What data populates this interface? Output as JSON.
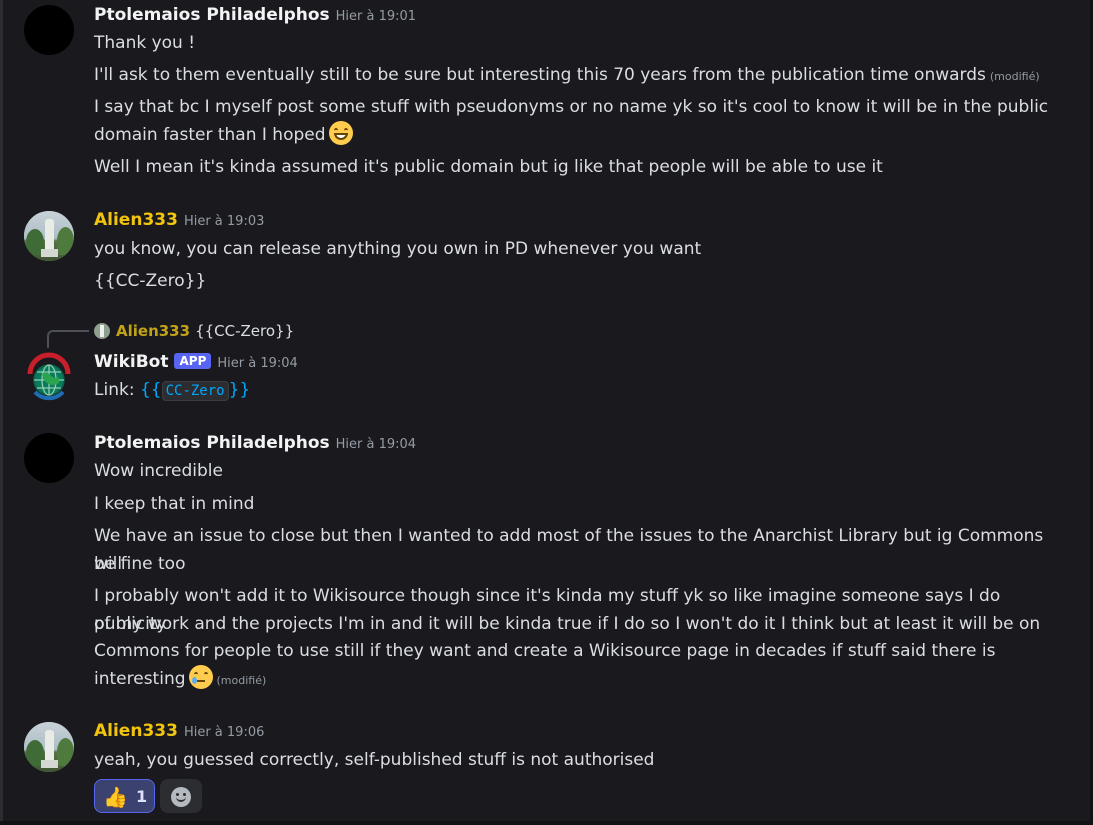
{
  "messages": [
    {
      "author": "Ptolemaios Philadelphos",
      "timestamp": "Hier à 19:01",
      "lines": [
        "Thank you !",
        "I'll ask to them eventually still to be sure but interesting this 70 years from the publication time onwards",
        "I say that bc I myself post some stuff with pseudonyms or no name yk so it's cool to know it will be in the public",
        "domain faster than I hoped",
        "Well I mean it's kinda assumed it's public domain but ig like that people will be able to use it"
      ],
      "edited_label": "(modifié)",
      "emoji": "grinning-face"
    },
    {
      "author": "Alien333",
      "timestamp": "Hier à 19:03",
      "lines": [
        "you know, you can release anything you own in PD whenever you want",
        "{{CC-Zero}}"
      ]
    },
    {
      "reply_to": {
        "author": "Alien333",
        "text": "{{CC-Zero}}"
      },
      "author": "WikiBot",
      "badge": "APP",
      "timestamp": "Hier à 19:04",
      "link_prefix": "Link: ",
      "link_open": "{{",
      "link_code": "CC-Zero",
      "link_close": "}}"
    },
    {
      "author": "Ptolemaios Philadelphos",
      "timestamp": "Hier à 19:04",
      "lines": [
        "Wow incredible",
        "I keep that in mind",
        "We have an issue to close but then I wanted to add most of the issues to the Anarchist Library but ig Commons will",
        "be fine too",
        "I probably won't add it to Wikisource though since it's kinda my stuff yk so like imagine someone says I do publicity",
        "of my work and the projects I'm in and it will be kinda true if I do so I won't do it I think but at least it will be on",
        "Commons for people to use still if they want and create a Wikisource page in decades if stuff said there is",
        "interesting"
      ],
      "edited_label": "(modifié)",
      "emoji": "face-holding-back-tears"
    },
    {
      "author": "Alien333",
      "timestamp": "Hier à 19:06",
      "lines": [
        "yeah, you guessed correctly, self-published stuff is not authorised"
      ],
      "reactions": [
        {
          "emoji": "thumbs-up-icon",
          "glyph": "👍",
          "count": "1"
        },
        {
          "emoji": "add-reaction-icon"
        }
      ]
    }
  ],
  "colors": {
    "background": "#1a1a1e",
    "username_default": "#f2f3f5",
    "username_alien": "#f1c40f",
    "timestamp": "#949ba4",
    "app_badge": "#5865f2",
    "link": "#00a8fc"
  }
}
